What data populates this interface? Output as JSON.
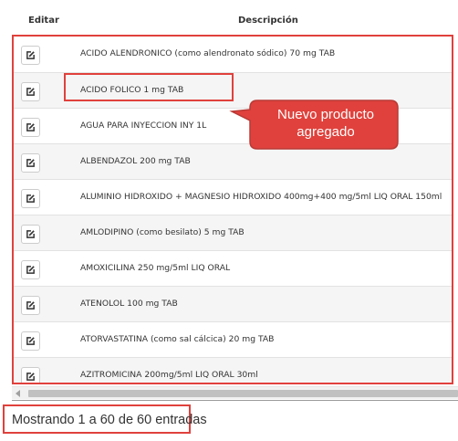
{
  "table": {
    "headers": {
      "edit": "Editar",
      "description": "Descripción"
    },
    "rows": [
      {
        "description": "ACIDO ALENDRONICO (como alendronato sódico) 70 mg TAB"
      },
      {
        "description": "ACIDO FOLICO 1 mg TAB"
      },
      {
        "description": "AGUA PARA INYECCION INY 1L"
      },
      {
        "description": "ALBENDAZOL 200 mg TAB"
      },
      {
        "description": "ALUMINIO HIDROXIDO + MAGNESIO HIDROXIDO 400mg+400 mg/5ml LIQ ORAL 150ml"
      },
      {
        "description": "AMLODIPINO (como besilato) 5 mg TAB"
      },
      {
        "description": "AMOXICILINA 250 mg/5ml LIQ ORAL"
      },
      {
        "description": "ATENOLOL 100 mg TAB"
      },
      {
        "description": "ATORVASTATINA (como sal cálcica) 20 mg TAB"
      },
      {
        "description": "AZITROMICINA 200mg/5ml LIQ ORAL 30ml"
      }
    ],
    "edit_icon": "edit-icon"
  },
  "annotation": {
    "line1": "Nuevo producto",
    "line2": "agregado",
    "color": "#e0413c"
  },
  "footer": {
    "info": "Mostrando 1 a 60 de 60 entradas"
  }
}
